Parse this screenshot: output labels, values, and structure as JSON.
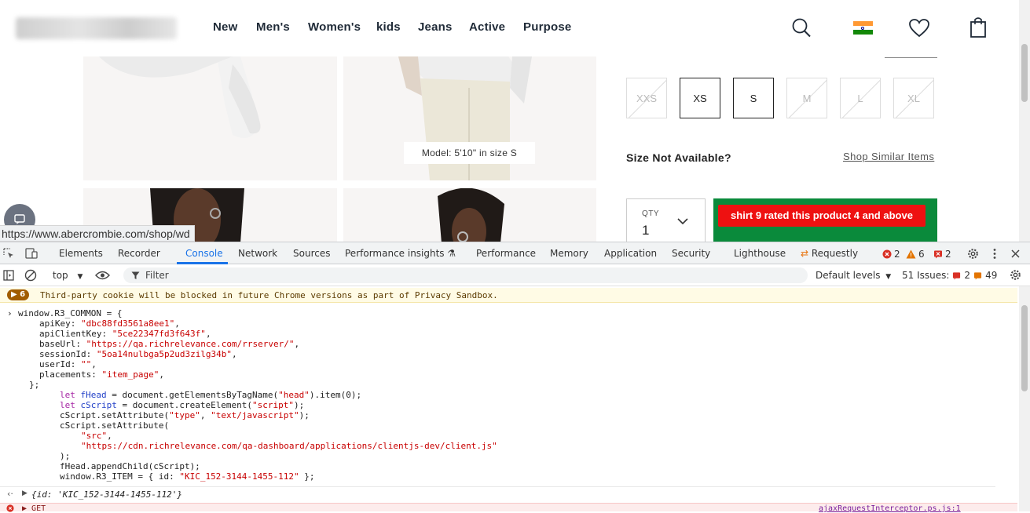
{
  "nav": {
    "items": [
      "New",
      "Men's",
      "Women's",
      "kids",
      "Jeans",
      "Active",
      "Purpose"
    ]
  },
  "product": {
    "model_caption": "Model: 5'10\" in size S",
    "sizes": [
      {
        "label": "XXS",
        "available": false
      },
      {
        "label": "XS",
        "available": true
      },
      {
        "label": "S",
        "available": true
      },
      {
        "label": "M",
        "available": false
      },
      {
        "label": "L",
        "available": false
      },
      {
        "label": "XL",
        "available": false
      }
    ],
    "size_not_available": "Size Not Available?",
    "shop_similar": "Shop Similar Items",
    "qty_label": "QTY",
    "qty_value": "1",
    "toast": "shirt 9 rated this product 4 and above",
    "accent_color": "#0a8a3b",
    "toast_color": "#ee1111"
  },
  "status_url": "https://www.abercrombie.com/shop/wd",
  "devtools": {
    "tabs": [
      "Elements",
      "Recorder",
      "Console",
      "Network",
      "Sources",
      "Performance insights",
      "Performance",
      "Memory",
      "Application",
      "Security",
      "Lighthouse",
      "Requestly"
    ],
    "active_tab": "Console",
    "errors": "2",
    "warnings": "6",
    "issues_badge": "2",
    "context": "top",
    "filter_placeholder": "Filter",
    "default_levels": "Default levels",
    "issues_label": "51 Issues:",
    "issues_errors": "2",
    "issues_warnings": "49",
    "warning_count": "6",
    "warning_message": "Third-party cookie will be blocked in future Chrome versions as part of Privacy Sandbox.",
    "result": "{id: 'KIC_152-3144-1455-112'}",
    "error_line": "GET",
    "error_source": "ajaxRequestInterceptor.ps.js:1"
  }
}
